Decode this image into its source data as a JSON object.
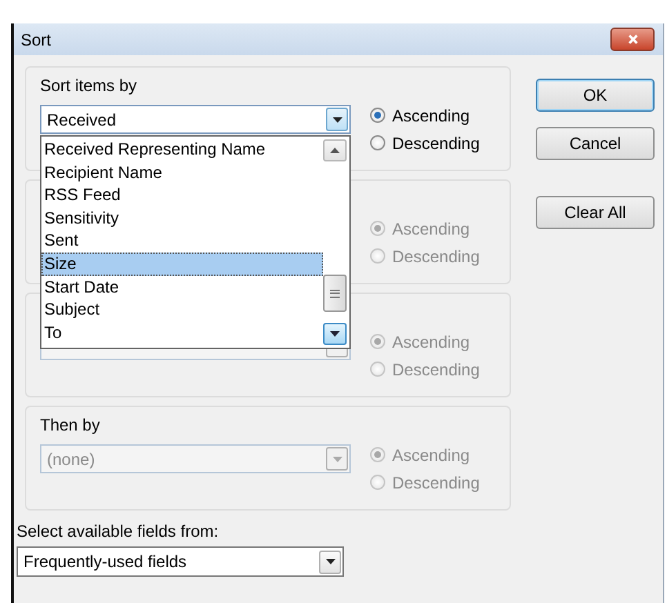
{
  "window": {
    "title": "Sort"
  },
  "groups": [
    {
      "label": "Sort items by",
      "disabled": false,
      "field": {
        "value": "Received"
      },
      "options": [
        {
          "label": "Ascending",
          "selected": true
        },
        {
          "label": "Descending",
          "selected": false
        }
      ]
    },
    {
      "disabled": true,
      "options": [
        {
          "label": "Ascending",
          "selected": true
        },
        {
          "label": "Descending",
          "selected": false
        }
      ]
    },
    {
      "disabled": true,
      "field": {
        "disabled": true
      },
      "options": [
        {
          "label": "Ascending",
          "selected": true
        },
        {
          "label": "Descending",
          "selected": false
        }
      ]
    },
    {
      "label": "Then by",
      "disabled": true,
      "field": {
        "value": "(none)"
      },
      "options": [
        {
          "label": "Ascending",
          "selected": true
        },
        {
          "label": "Descending",
          "selected": false
        }
      ]
    }
  ],
  "dropdown_list": {
    "items": [
      {
        "label": "Received Representing Name",
        "selected": false
      },
      {
        "label": "Recipient Name",
        "selected": false
      },
      {
        "label": "RSS Feed",
        "selected": false
      },
      {
        "label": "Sensitivity",
        "selected": false
      },
      {
        "label": "Sent",
        "selected": false
      },
      {
        "label": "Size",
        "selected": true
      },
      {
        "label": "Start Date",
        "selected": false
      },
      {
        "label": "Subject",
        "selected": false
      },
      {
        "label": "To",
        "selected": false
      }
    ]
  },
  "buttons": [
    {
      "label": "OK",
      "default": true
    },
    {
      "label": "Cancel",
      "default": false
    },
    {
      "label": "Clear All",
      "default": false
    }
  ],
  "fields_from": {
    "label": "Select available fields from:",
    "value": "Frequently-used fields"
  }
}
